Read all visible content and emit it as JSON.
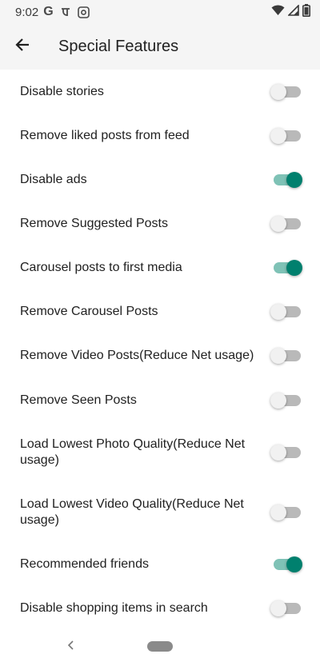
{
  "status_bar": {
    "time": "9:02",
    "left_icons": [
      "google-g-icon",
      "notification-icon",
      "app-notification-icon"
    ],
    "right_icons": [
      "wifi-icon",
      "cellular-signal-icon",
      "battery-icon"
    ]
  },
  "app_bar": {
    "title": "Special Features",
    "back_icon": "arrow-left-icon"
  },
  "settings": [
    {
      "label": "Disable stories",
      "enabled": false
    },
    {
      "label": "Remove liked posts from feed",
      "enabled": false
    },
    {
      "label": "Disable ads",
      "enabled": true
    },
    {
      "label": "Remove Suggested Posts",
      "enabled": false
    },
    {
      "label": "Carousel posts to first media",
      "enabled": true
    },
    {
      "label": "Remove Carousel Posts",
      "enabled": false
    },
    {
      "label": "Remove Video Posts(Reduce Net usage)",
      "enabled": false
    },
    {
      "label": "Remove Seen Posts",
      "enabled": false
    },
    {
      "label": "Load Lowest Photo Quality(Reduce Net usage)",
      "enabled": false
    },
    {
      "label": "Load Lowest Video Quality(Reduce Net usage)",
      "enabled": false
    },
    {
      "label": "Recommended friends",
      "enabled": true
    },
    {
      "label": "Disable shopping items in search",
      "enabled": false
    }
  ],
  "colors": {
    "switch_on_thumb": "#00806e",
    "switch_on_track": "#7fc2b6",
    "switch_off_thumb": "#f1f1f1",
    "switch_off_track": "#b9b9b9",
    "app_bar_bg": "#f5f5f5"
  },
  "nav_bar": {
    "back_icon": "nav-back-chevron-icon",
    "home_icon": "home-pill-icon"
  }
}
